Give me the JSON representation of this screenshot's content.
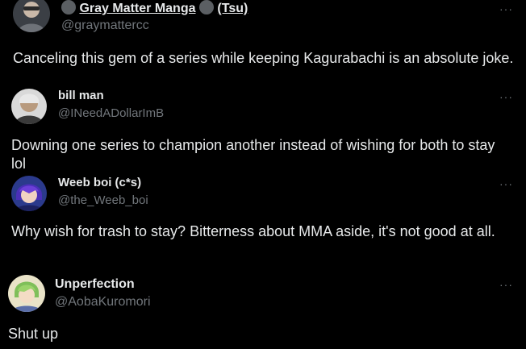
{
  "colors": {
    "background": "#000000",
    "primary_text": "#e7e9ea",
    "secondary_text": "#71767b"
  },
  "posts": [
    {
      "name_part1": "Gray Matter Manga",
      "name_part2": "(Tsu)",
      "handle": "@graymattercc",
      "more": "···",
      "text": "Canceling this gem of a series while keeping Kagurabachi is an absolute joke."
    },
    {
      "name": "bill man",
      "handle": "@INeedADollarImB",
      "more": "···",
      "text": "Downing one series to champion another instead of wishing for both to stay  lol"
    },
    {
      "name": "Weeb boi (c*s)",
      "handle": "@the_Weeb_boi",
      "more": "···",
      "text": "Why wish for trash to stay? Bitterness about MMA aside, it's not good at all."
    },
    {
      "name": "Unperfection",
      "handle": "@AobaKuromori",
      "more": "···",
      "text": "Shut up"
    }
  ]
}
